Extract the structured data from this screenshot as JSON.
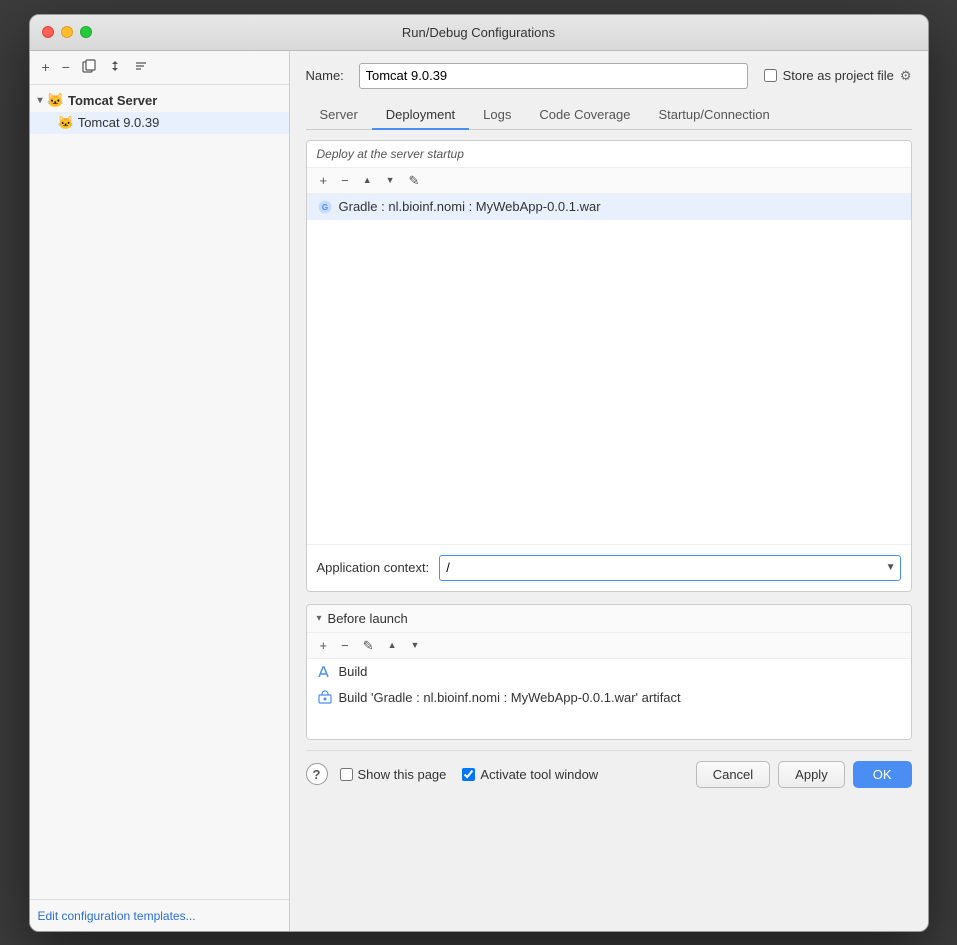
{
  "window": {
    "title": "Run/Debug Configurations"
  },
  "sidebar": {
    "toolbar": {
      "add": "+",
      "remove": "−",
      "copy": "⊡",
      "move": "⇅",
      "sort": "⇕"
    },
    "group_label": "Tomcat Server",
    "items": [
      {
        "label": "Tomcat 9.0.39"
      }
    ],
    "footer_link": "Edit configuration templates..."
  },
  "header": {
    "name_label": "Name:",
    "name_value": "Tomcat 9.0.39",
    "store_label": "Store as project file"
  },
  "tabs": [
    {
      "label": "Server",
      "active": false
    },
    {
      "label": "Deployment",
      "active": true
    },
    {
      "label": "Logs",
      "active": false
    },
    {
      "label": "Code Coverage",
      "active": false
    },
    {
      "label": "Startup/Connection",
      "active": false
    }
  ],
  "deployment": {
    "section_title": "Deploy at the server startup",
    "artifact_toolbar": {
      "add": "+",
      "remove": "−",
      "move_up": "▲",
      "move_down": "▼",
      "edit": "✎"
    },
    "artifacts": [
      {
        "label": "Gradle : nl.bioinf.nomi : MyWebApp-0.0.1.war"
      }
    ],
    "app_context_label": "Application context:",
    "app_context_value": "/"
  },
  "before_launch": {
    "section_title": "Before launch",
    "toolbar": {
      "add": "+",
      "remove": "−",
      "edit": "✎",
      "move_up": "▲",
      "move_down": "▼"
    },
    "items": [
      {
        "label": "Build",
        "type": "build"
      },
      {
        "label": "Build 'Gradle : nl.bioinf.nomi : MyWebApp-0.0.1.war' artifact",
        "type": "artifact"
      }
    ]
  },
  "bottom": {
    "show_page_label": "Show this page",
    "activate_tool_label": "Activate tool window",
    "show_page_checked": false,
    "activate_tool_checked": true,
    "cancel_label": "Cancel",
    "apply_label": "Apply",
    "ok_label": "OK",
    "help_label": "?"
  }
}
